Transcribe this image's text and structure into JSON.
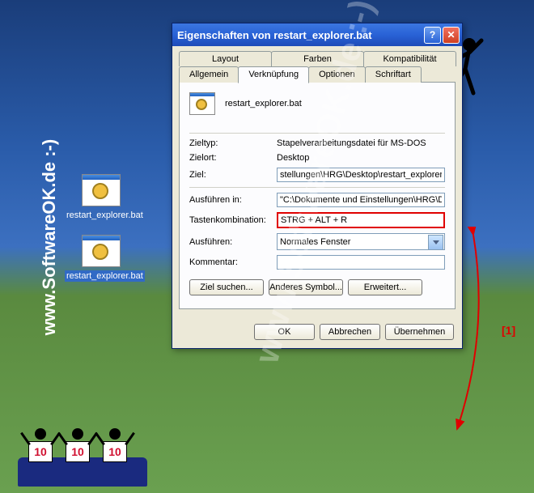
{
  "watermark": "www.SoftwareOK.de :-)",
  "desktop": {
    "icons": [
      {
        "label": "restart_explorer.bat"
      },
      {
        "label": "restart_explorer.bat"
      }
    ]
  },
  "dialog": {
    "title": "Eigenschaften von restart_explorer.bat",
    "tabs_back": [
      "Layout",
      "Farben",
      "Kompatibilität"
    ],
    "tabs_front": [
      "Allgemein",
      "Verknüpfung",
      "Optionen",
      "Schriftart"
    ],
    "file_name": "restart_explorer.bat",
    "fields": {
      "zieltyp_label": "Zieltyp:",
      "zieltyp_value": "Stapelverarbeitungsdatei für MS-DOS",
      "zielort_label": "Zielort:",
      "zielort_value": "Desktop",
      "ziel_label": "Ziel:",
      "ziel_value": "stellungen\\HRG\\Desktop\\restart_explorer.bat\"",
      "ausfuehren_in_label": "Ausführen in:",
      "ausfuehren_in_value": "\"C:\\Dokumente und Einstellungen\\HRG\\Desk",
      "tastenkombination_label": "Tastenkombination:",
      "tastenkombination_value": "STRG + ALT + R",
      "ausfuehren_label": "Ausführen:",
      "ausfuehren_value": "Normales Fenster",
      "kommentar_label": "Kommentar:",
      "kommentar_value": ""
    },
    "buttons": {
      "ziel_suchen": "Ziel suchen...",
      "anderes_symbol": "Anderes Symbol...",
      "erweitert": "Erweitert...",
      "ok": "OK",
      "abbrechen": "Abbrechen",
      "uebernehmen": "Übernehmen"
    }
  },
  "annotation": "[1]",
  "judges_score": "10"
}
